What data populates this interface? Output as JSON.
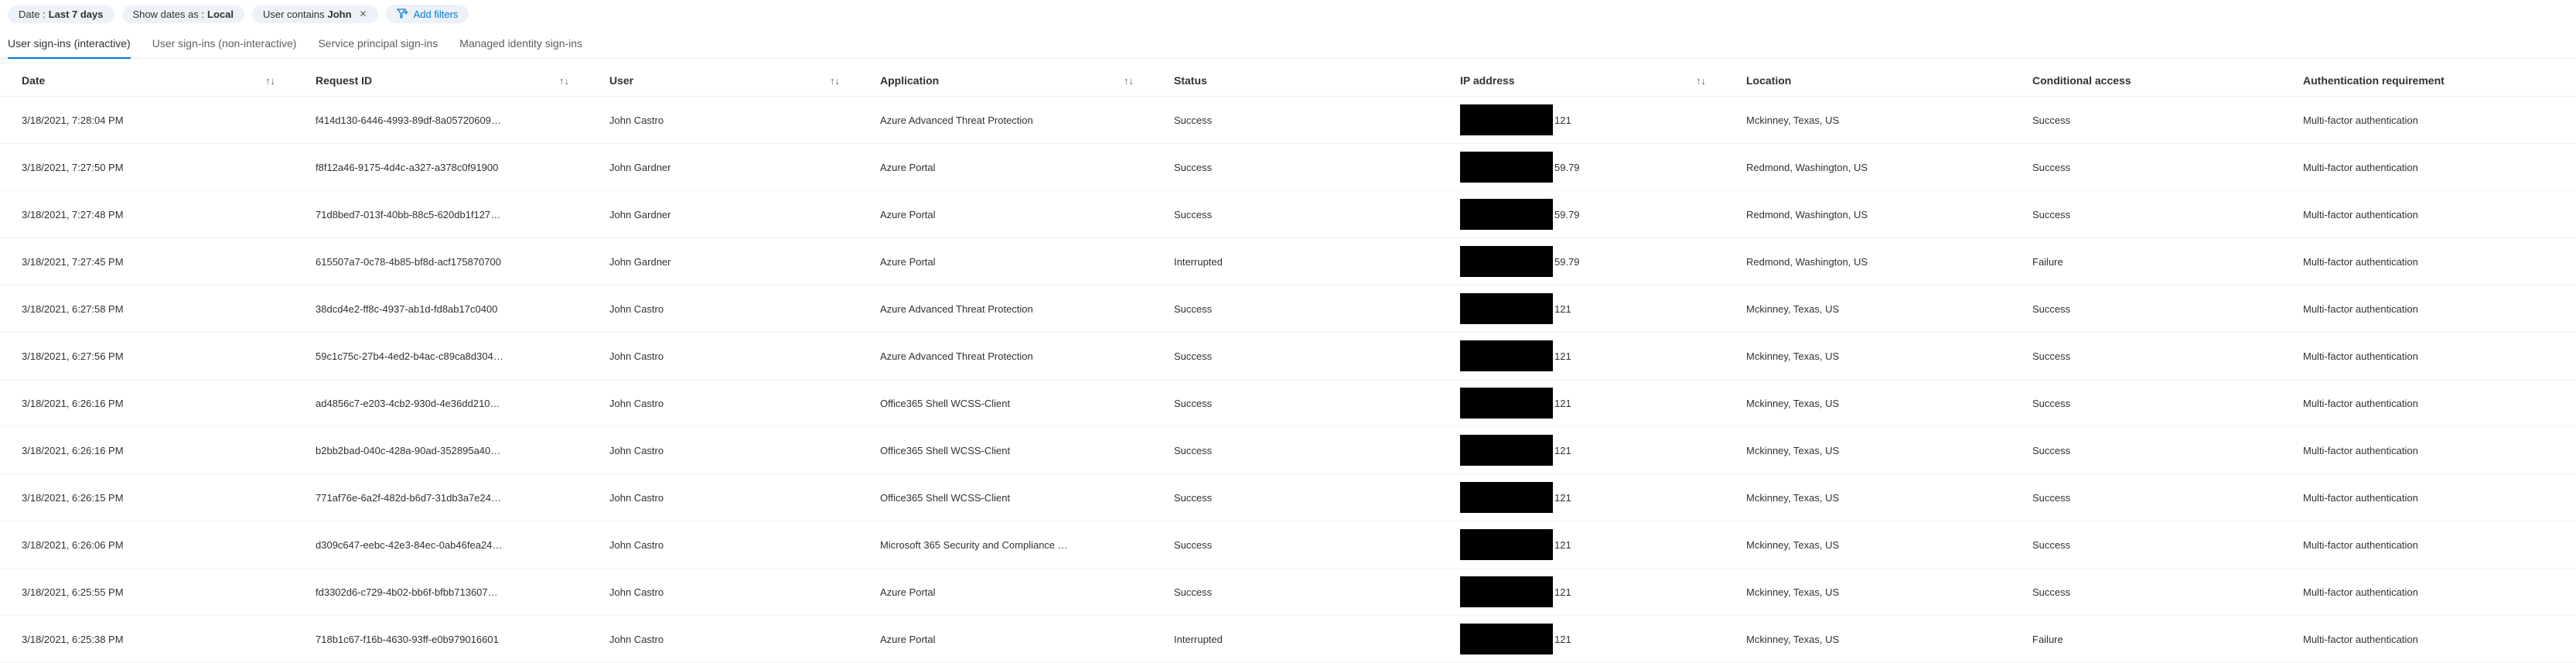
{
  "filters": {
    "date": {
      "label": "Date :",
      "value": "Last 7 days"
    },
    "tz": {
      "label": "Show dates as :",
      "value": "Local"
    },
    "user": {
      "label": "User contains",
      "value": "John"
    },
    "add": {
      "label": "Add filters"
    }
  },
  "tabs": [
    {
      "label": "User sign-ins (interactive)",
      "active": true
    },
    {
      "label": "User sign-ins (non-interactive)",
      "active": false
    },
    {
      "label": "Service principal sign-ins",
      "active": false
    },
    {
      "label": "Managed identity sign-ins",
      "active": false
    }
  ],
  "columns": {
    "date": {
      "label": "Date",
      "sortable": true
    },
    "request_id": {
      "label": "Request ID",
      "sortable": true
    },
    "user": {
      "label": "User",
      "sortable": true
    },
    "app": {
      "label": "Application",
      "sortable": true
    },
    "status": {
      "label": "Status",
      "sortable": false
    },
    "ip": {
      "label": "IP address",
      "sortable": true
    },
    "location": {
      "label": "Location",
      "sortable": false
    },
    "ca": {
      "label": "Conditional access",
      "sortable": false
    },
    "authreq": {
      "label": "Authentication requirement",
      "sortable": false
    }
  },
  "rows": [
    {
      "date": "3/18/2021, 7:28:04 PM",
      "request_id": "f414d130-6446-4993-89df-8a05720609…",
      "user": "John Castro",
      "app": "Azure Advanced Threat Protection",
      "status": "Success",
      "ip_suffix": "121",
      "location": "Mckinney, Texas, US",
      "ca": "Success",
      "authreq": "Multi-factor authentication"
    },
    {
      "date": "3/18/2021, 7:27:50 PM",
      "request_id": "f8f12a46-9175-4d4c-a327-a378c0f91900",
      "user": "John Gardner",
      "app": "Azure Portal",
      "status": "Success",
      "ip_suffix": "59.79",
      "location": "Redmond, Washington, US",
      "ca": "Success",
      "authreq": "Multi-factor authentication"
    },
    {
      "date": "3/18/2021, 7:27:48 PM",
      "request_id": "71d8bed7-013f-40bb-88c5-620db1f127…",
      "user": "John Gardner",
      "app": "Azure Portal",
      "status": "Success",
      "ip_suffix": "59.79",
      "location": "Redmond, Washington, US",
      "ca": "Success",
      "authreq": "Multi-factor authentication"
    },
    {
      "date": "3/18/2021, 7:27:45 PM",
      "request_id": "615507a7-0c78-4b85-bf8d-acf175870700",
      "user": "John Gardner",
      "app": "Azure Portal",
      "status": "Interrupted",
      "ip_suffix": "59.79",
      "location": "Redmond, Washington, US",
      "ca": "Failure",
      "authreq": "Multi-factor authentication"
    },
    {
      "date": "3/18/2021, 6:27:58 PM",
      "request_id": "38dcd4e2-ff8c-4937-ab1d-fd8ab17c0400",
      "user": "John Castro",
      "app": "Azure Advanced Threat Protection",
      "status": "Success",
      "ip_suffix": "121",
      "location": "Mckinney, Texas, US",
      "ca": "Success",
      "authreq": "Multi-factor authentication"
    },
    {
      "date": "3/18/2021, 6:27:56 PM",
      "request_id": "59c1c75c-27b4-4ed2-b4ac-c89ca8d304…",
      "user": "John Castro",
      "app": "Azure Advanced Threat Protection",
      "status": "Success",
      "ip_suffix": "121",
      "location": "Mckinney, Texas, US",
      "ca": "Success",
      "authreq": "Multi-factor authentication"
    },
    {
      "date": "3/18/2021, 6:26:16 PM",
      "request_id": "ad4856c7-e203-4cb2-930d-4e36dd210…",
      "user": "John Castro",
      "app": "Office365 Shell WCSS-Client",
      "status": "Success",
      "ip_suffix": "121",
      "location": "Mckinney, Texas, US",
      "ca": "Success",
      "authreq": "Multi-factor authentication"
    },
    {
      "date": "3/18/2021, 6:26:16 PM",
      "request_id": "b2bb2bad-040c-428a-90ad-352895a40…",
      "user": "John Castro",
      "app": "Office365 Shell WCSS-Client",
      "status": "Success",
      "ip_suffix": "121",
      "location": "Mckinney, Texas, US",
      "ca": "Success",
      "authreq": "Multi-factor authentication"
    },
    {
      "date": "3/18/2021, 6:26:15 PM",
      "request_id": "771af76e-6a2f-482d-b6d7-31db3a7e24…",
      "user": "John Castro",
      "app": "Office365 Shell WCSS-Client",
      "status": "Success",
      "ip_suffix": "121",
      "location": "Mckinney, Texas, US",
      "ca": "Success",
      "authreq": "Multi-factor authentication"
    },
    {
      "date": "3/18/2021, 6:26:06 PM",
      "request_id": "d309c647-eebc-42e3-84ec-0ab46fea24…",
      "user": "John Castro",
      "app": "Microsoft 365 Security and Compliance …",
      "status": "Success",
      "ip_suffix": "121",
      "location": "Mckinney, Texas, US",
      "ca": "Success",
      "authreq": "Multi-factor authentication"
    },
    {
      "date": "3/18/2021, 6:25:55 PM",
      "request_id": "fd3302d6-c729-4b02-bb6f-bfbb713607…",
      "user": "John Castro",
      "app": "Azure Portal",
      "status": "Success",
      "ip_suffix": "121",
      "location": "Mckinney, Texas, US",
      "ca": "Success",
      "authreq": "Multi-factor authentication"
    },
    {
      "date": "3/18/2021, 6:25:38 PM",
      "request_id": "718b1c67-f16b-4630-93ff-e0b979016601",
      "user": "John Castro",
      "app": "Azure Portal",
      "status": "Interrupted",
      "ip_suffix": "121",
      "location": "Mckinney, Texas, US",
      "ca": "Failure",
      "authreq": "Multi-factor authentication"
    }
  ]
}
